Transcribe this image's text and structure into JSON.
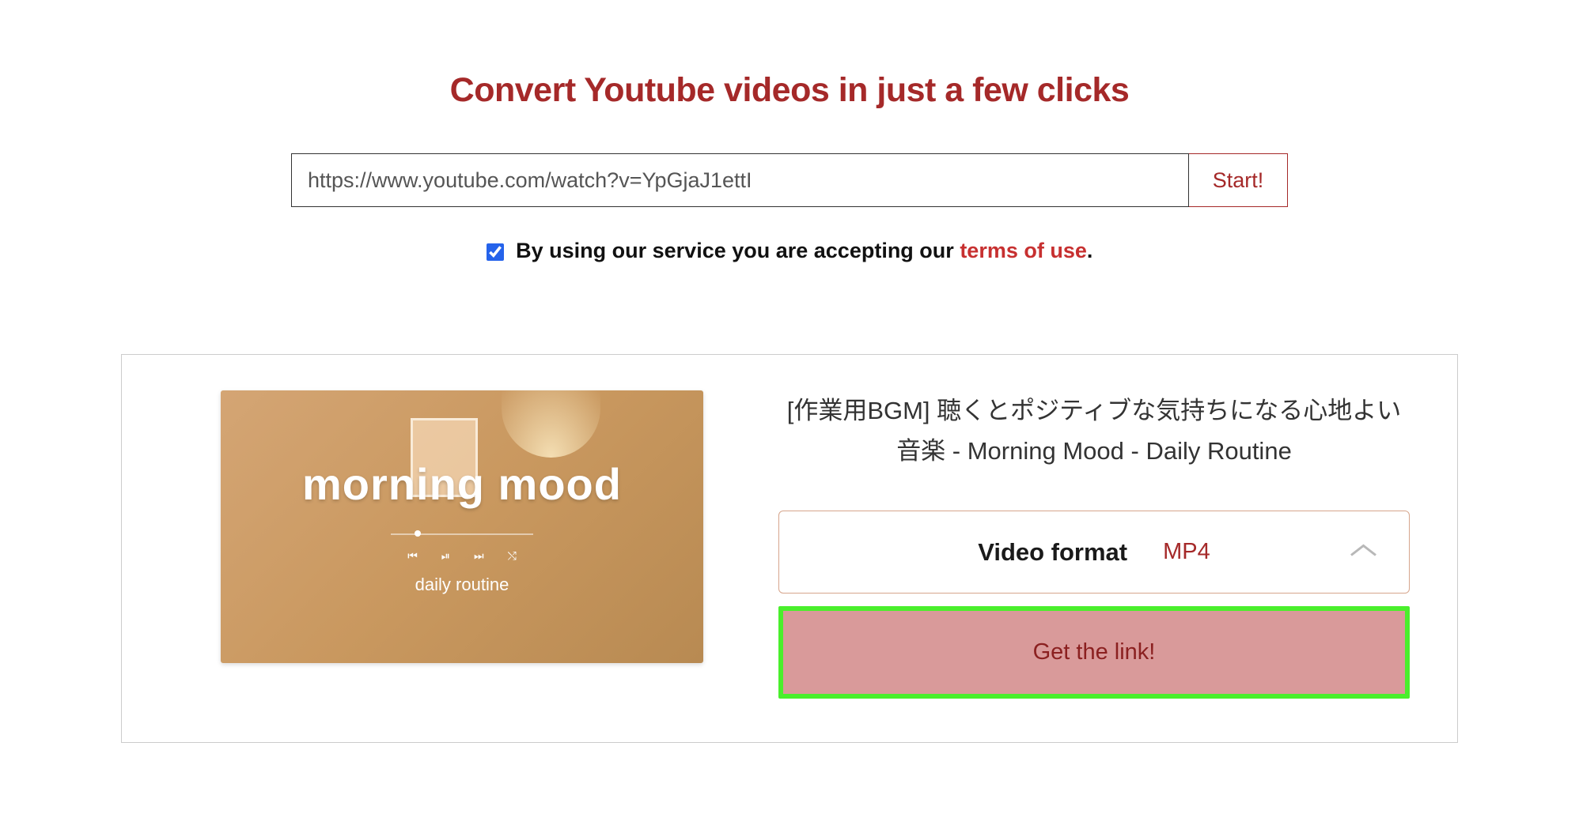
{
  "heading": "Convert Youtube videos in just a few clicks",
  "url_input": {
    "value": "https://www.youtube.com/watch?v=YpGjaJ1ettI"
  },
  "start_button": "Start!",
  "terms": {
    "pre_text": "By using our service you are accepting our ",
    "link_text": "terms of use",
    "post_text": "."
  },
  "result": {
    "video_title": "[作業用BGM] 聴くとポジティブな気持ちになる心地よい音楽 - Morning Mood - Daily Routine",
    "thumb_title": "morning mood",
    "thumb_sub": "daily routine",
    "format_label": "Video format",
    "format_value": "MP4",
    "get_link": "Get the link!"
  }
}
